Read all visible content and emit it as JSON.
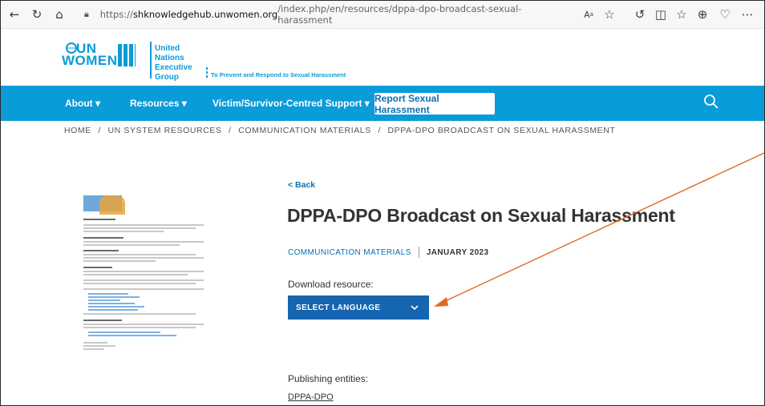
{
  "browser": {
    "url_prefix": "https://",
    "url_host": "shknowledgehub.unwomen.org",
    "url_rest": "/index.php/en/resources/dppa-dpo-broadcast-sexual-harassment",
    "icons": [
      "back-arrow-icon",
      "refresh-icon",
      "home-icon",
      "lock-icon",
      "read-aloud-icon",
      "favorite-star-icon",
      "extension-icon",
      "split-screen-icon",
      "favorites-list-icon",
      "collections-icon",
      "browser-essentials-icon",
      "more-icon"
    ]
  },
  "header": {
    "logo_line1": "UN",
    "logo_line2": "WOMEN",
    "group_lines": [
      "United Nations",
      "Executive",
      "Group"
    ],
    "tagline": "To Prevent and Respond to Sexual Harassment"
  },
  "nav": {
    "items": [
      {
        "label": "About ▾"
      },
      {
        "label": "Resources ▾"
      },
      {
        "label": "Victim/Survivor-Centred Support ▾"
      }
    ],
    "report_button": "Report Sexual Harassment",
    "search_icon": "search-icon",
    "accent": "#0a9bd9"
  },
  "breadcrumb": [
    "HOME",
    "/",
    "UN SYSTEM RESOURCES",
    "/",
    "COMMUNICATION MATERIALS",
    "/",
    "DPPA-DPO BROADCAST ON SEXUAL HARASSMENT"
  ],
  "article": {
    "back_label": "< Back",
    "title": "DPPA-DPO Broadcast on Sexual Harassment",
    "category": "COMMUNICATION MATERIALS",
    "date": "JANUARY 2023",
    "download_label": "Download resource:",
    "select_language": "SELECT LANGUAGE",
    "publishing_label": "Publishing entities:",
    "publisher": "DPPA-DPO"
  },
  "colors": {
    "primary_blue": "#0a9bd9",
    "button_blue": "#1565b0",
    "annotation_arrow": "#e0691f"
  }
}
